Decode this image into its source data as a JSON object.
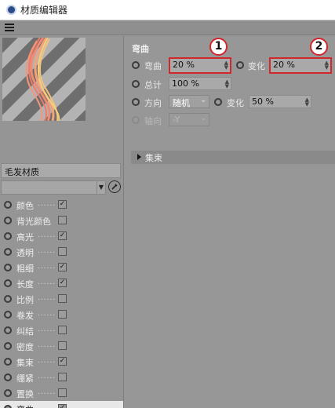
{
  "window": {
    "title": "材质编辑器"
  },
  "material": {
    "name": "毛发材质"
  },
  "channels": [
    {
      "label": "颜色",
      "checked": true
    },
    {
      "label": "背光颜色",
      "checked": false
    },
    {
      "label": "高光",
      "checked": true
    },
    {
      "label": "透明",
      "checked": false
    },
    {
      "label": "粗细",
      "checked": true
    },
    {
      "label": "长度",
      "checked": true
    },
    {
      "label": "比例",
      "checked": false
    },
    {
      "label": "卷发",
      "checked": false
    },
    {
      "label": "纠结",
      "checked": false
    },
    {
      "label": "密度",
      "checked": false
    },
    {
      "label": "集束",
      "checked": true
    },
    {
      "label": "绷紧",
      "checked": false
    },
    {
      "label": "置换",
      "checked": false
    },
    {
      "label": "弯曲",
      "checked": true
    }
  ],
  "panel": {
    "section_title": "弯曲",
    "bend_label": "弯曲",
    "bend_value": "20 %",
    "variation_label": "变化",
    "variation_value": "20 %",
    "total_label": "总计",
    "total_value": "100 %",
    "direction_label": "方向",
    "direction_value": "随机",
    "direction_variation_label": "变化",
    "direction_variation_value": "50 %",
    "axis_label": "轴向",
    "axis_value": "-Y",
    "collapse_label": "集束"
  },
  "callouts": [
    "1",
    "2"
  ],
  "colors": {
    "highlight": "#d0282c",
    "panel_bg": "#979797"
  },
  "icons": {
    "app": "cinema4d-icon",
    "menu": "hamburger-menu-icon",
    "picker": "eyedropper-icon"
  }
}
